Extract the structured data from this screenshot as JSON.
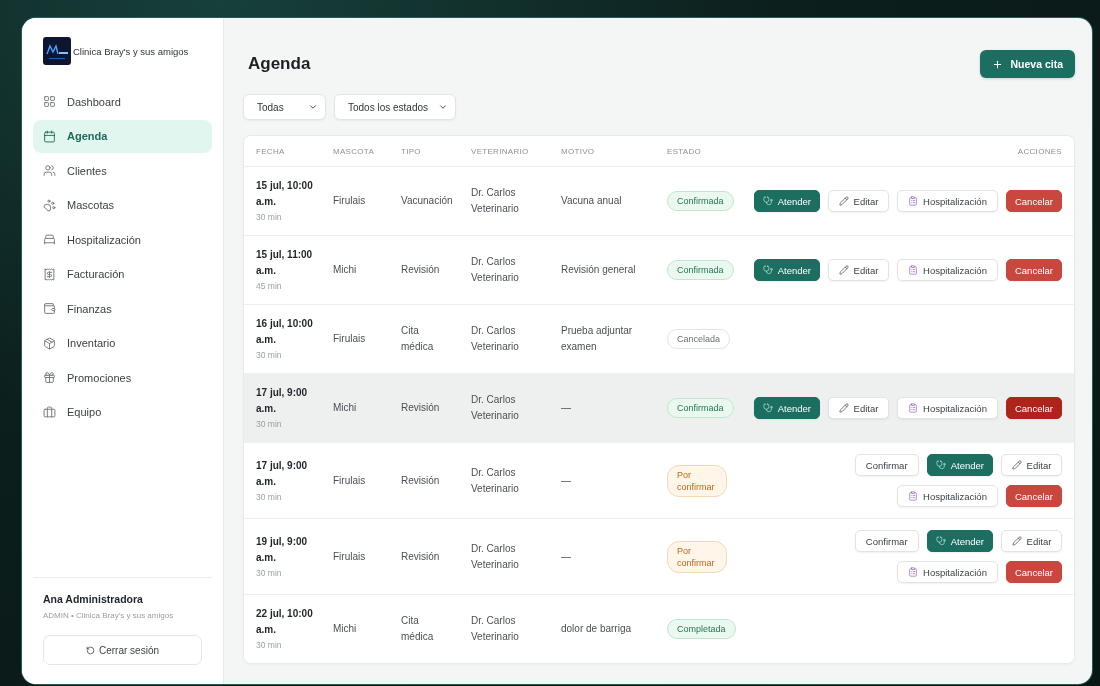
{
  "sidebar": {
    "brand": "Clinica Bray's y sus amigos",
    "items": [
      {
        "label": "Dashboard",
        "selected": false
      },
      {
        "label": "Agenda",
        "selected": true
      },
      {
        "label": "Clientes",
        "selected": false
      },
      {
        "label": "Mascotas",
        "selected": false
      },
      {
        "label": "Hospitalización",
        "selected": false
      },
      {
        "label": "Facturación",
        "selected": false
      },
      {
        "label": "Finanzas",
        "selected": false
      },
      {
        "label": "Inventario",
        "selected": false
      },
      {
        "label": "Promociones",
        "selected": false
      },
      {
        "label": "Equipo",
        "selected": false
      }
    ],
    "user": {
      "name": "Ana Administradora",
      "role": "ADMIN • Clinica Bray's y sus amigos"
    },
    "logout": "Cerrar sesión"
  },
  "page": {
    "title": "Agenda",
    "new_button": "Nueva cita",
    "filters": [
      {
        "value": "Todas"
      },
      {
        "value": "Todos los estados"
      }
    ]
  },
  "table": {
    "columns": [
      "FECHA",
      "MASCOTA",
      "TIPO",
      "VETERINARIO",
      "MOTIVO",
      "ESTADO",
      "ACCIONES"
    ],
    "rows": [
      {
        "date": "15 jul, 10:00 a.m.",
        "duration": "30 min",
        "pet": "Firulais",
        "type": "Vacunación",
        "vet": "Dr. Carlos Veterinario",
        "reason": "Vacuna anual",
        "status": {
          "label": "Confirmada",
          "kind": "confirmed"
        },
        "hovered": false,
        "actions": [
          {
            "kind": "attend",
            "label": "Atender"
          },
          {
            "kind": "edit",
            "label": "Editar"
          },
          {
            "kind": "hospitalize",
            "label": "Hospitalización"
          },
          {
            "kind": "cancel",
            "label": "Cancelar"
          }
        ]
      },
      {
        "date": "15 jul, 11:00 a.m.",
        "duration": "45 min",
        "pet": "Michi",
        "type": "Revisión",
        "vet": "Dr. Carlos Veterinario",
        "reason": "Revisión general",
        "status": {
          "label": "Confirmada",
          "kind": "confirmed"
        },
        "hovered": false,
        "actions": [
          {
            "kind": "attend",
            "label": "Atender"
          },
          {
            "kind": "edit",
            "label": "Editar"
          },
          {
            "kind": "hospitalize",
            "label": "Hospitalización"
          },
          {
            "kind": "cancel",
            "label": "Cancelar"
          }
        ]
      },
      {
        "date": "16 jul, 10:00 a.m.",
        "duration": "30 min",
        "pet": "Firulais",
        "type": "Cita médica",
        "vet": "Dr. Carlos Veterinario",
        "reason": "Prueba adjuntar examen",
        "status": {
          "label": "Cancelada",
          "kind": "cancelled"
        },
        "hovered": false
      },
      {
        "date": "17 jul, 9:00 a.m.",
        "duration": "30 min",
        "pet": "Michi",
        "type": "Revisión",
        "vet": "Dr. Carlos Veterinario",
        "reason": "—",
        "status": {
          "label": "Confirmada",
          "kind": "confirmed"
        },
        "hovered": true,
        "actions": [
          {
            "kind": "attend",
            "label": "Atender"
          },
          {
            "kind": "edit",
            "label": "Editar"
          },
          {
            "kind": "hospitalize",
            "label": "Hospitalización"
          },
          {
            "kind": "cancel",
            "label": "Cancelar"
          }
        ]
      },
      {
        "date": "17 jul, 9:00 a.m.",
        "duration": "30 min",
        "pet": "Firulais",
        "type": "Revisión",
        "vet": "Dr. Carlos Veterinario",
        "reason": "—",
        "status": {
          "label": "Por confirmar",
          "kind": "pending"
        },
        "hovered": false,
        "actions": [
          {
            "kind": "confirm",
            "label": "Confirmar"
          },
          {
            "kind": "attend",
            "label": "Atender"
          },
          {
            "kind": "edit",
            "label": "Editar"
          },
          {
            "kind": "hospitalize",
            "label": "Hospitalización"
          },
          {
            "kind": "cancel",
            "label": "Cancelar"
          }
        ]
      },
      {
        "date": "19 jul, 9:00 a.m.",
        "duration": "30 min",
        "pet": "Firulais",
        "type": "Revisión",
        "vet": "Dr. Carlos Veterinario",
        "reason": "—",
        "status": {
          "label": "Por confirmar",
          "kind": "pending"
        },
        "hovered": false,
        "actions": [
          {
            "kind": "confirm",
            "label": "Confirmar"
          },
          {
            "kind": "attend",
            "label": "Atender"
          },
          {
            "kind": "edit",
            "label": "Editar"
          },
          {
            "kind": "hospitalize",
            "label": "Hospitalización"
          },
          {
            "kind": "cancel",
            "label": "Cancelar"
          }
        ]
      },
      {
        "date": "22 jul, 10:00 a.m.",
        "duration": "30 min",
        "pet": "Michi",
        "type": "Cita médica",
        "vet": "Dr. Carlos Veterinario",
        "reason": "dolor de barriga",
        "status": {
          "label": "Completada",
          "kind": "completed"
        },
        "hovered": false
      }
    ]
  }
}
